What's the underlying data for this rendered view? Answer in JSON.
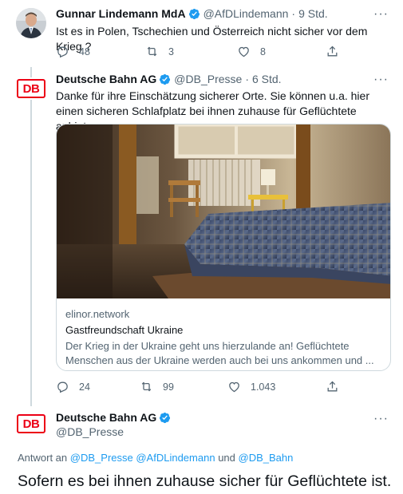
{
  "tweet1": {
    "name": "Gunnar Lindemann MdA",
    "handle": "@AfDLindemann",
    "dot": "·",
    "time": "9 Std.",
    "text": "Ist es in Polen, Tschechien und Österreich nicht sicher vor dem Krieg ?",
    "replies": "48",
    "retweets": "3",
    "likes": "8"
  },
  "tweet2": {
    "name": "Deutsche Bahn AG",
    "handle": "@DB_Presse",
    "dot": "·",
    "time": "6 Std.",
    "text": "Danke für ihre Einschätzung sicherer Orte. Sie können u.a. hier einen sicheren Schlafplatz bei ihnen zuhause für Geflüchtete anbieten:",
    "card": {
      "domain": "elinor.network",
      "title": "Gastfreundschaft Ukraine",
      "description": "Der Krieg in der Ukraine geht uns hierzulande an! Geflüchtete Menschen aus der Ukraine werden auch bei uns ankommen und ..."
    },
    "replies": "24",
    "retweets": "99",
    "likes": "1.043"
  },
  "tweet3": {
    "name": "Deutsche Bahn AG",
    "handle": "@DB_Presse",
    "reply_prefix": "Antwort an",
    "mention1": "@DB_Presse",
    "mention2": "@AfDLindemann",
    "conj": "und",
    "mention3": "@DB_Bahn",
    "text": "Sofern es bei ihnen zuhause sicher für Geflüchtete ist."
  },
  "logo": {
    "db_text": "DB"
  },
  "more_label": "···",
  "colors": {
    "accent": "#1d9bf0",
    "db_red": "#ec0016",
    "muted": "#536471"
  }
}
